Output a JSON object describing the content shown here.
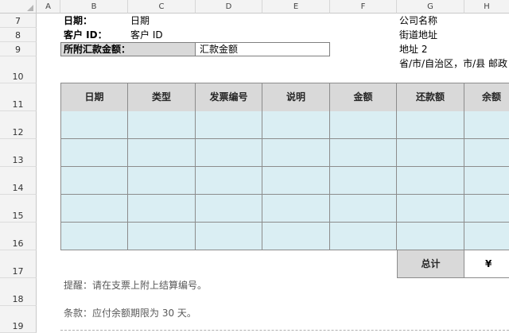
{
  "columns": [
    "A",
    "B",
    "C",
    "D",
    "E",
    "F",
    "G",
    "H"
  ],
  "rows": [
    "7",
    "8",
    "9",
    "10",
    "11",
    "12",
    "13",
    "14",
    "15",
    "16",
    "17",
    "18",
    "19"
  ],
  "invoice": {
    "date_label": "日期：",
    "date_value": "日期",
    "customer_label": "客户 ID：",
    "customer_value": "客户 ID",
    "remit_label": "所附汇款金额：",
    "remit_value": "汇款金额"
  },
  "company": {
    "name": "公司名称",
    "street": "街道地址",
    "address2": "地址 2",
    "region": "省/市/自治区，市/县 邮政"
  },
  "table": {
    "headers": [
      "日期",
      "类型",
      "发票编号",
      "说明",
      "金额",
      "还款额",
      "余额"
    ],
    "total_label": "总计",
    "total_value": "¥"
  },
  "notes": {
    "reminder": "提醒：请在支票上附上结算编号。",
    "terms": "条款：应付余额期限为 30 天。"
  },
  "colors": {
    "header_fill": "#d9d9d9",
    "data_fill": "#daeef3",
    "grid": "#8c8c8c"
  }
}
